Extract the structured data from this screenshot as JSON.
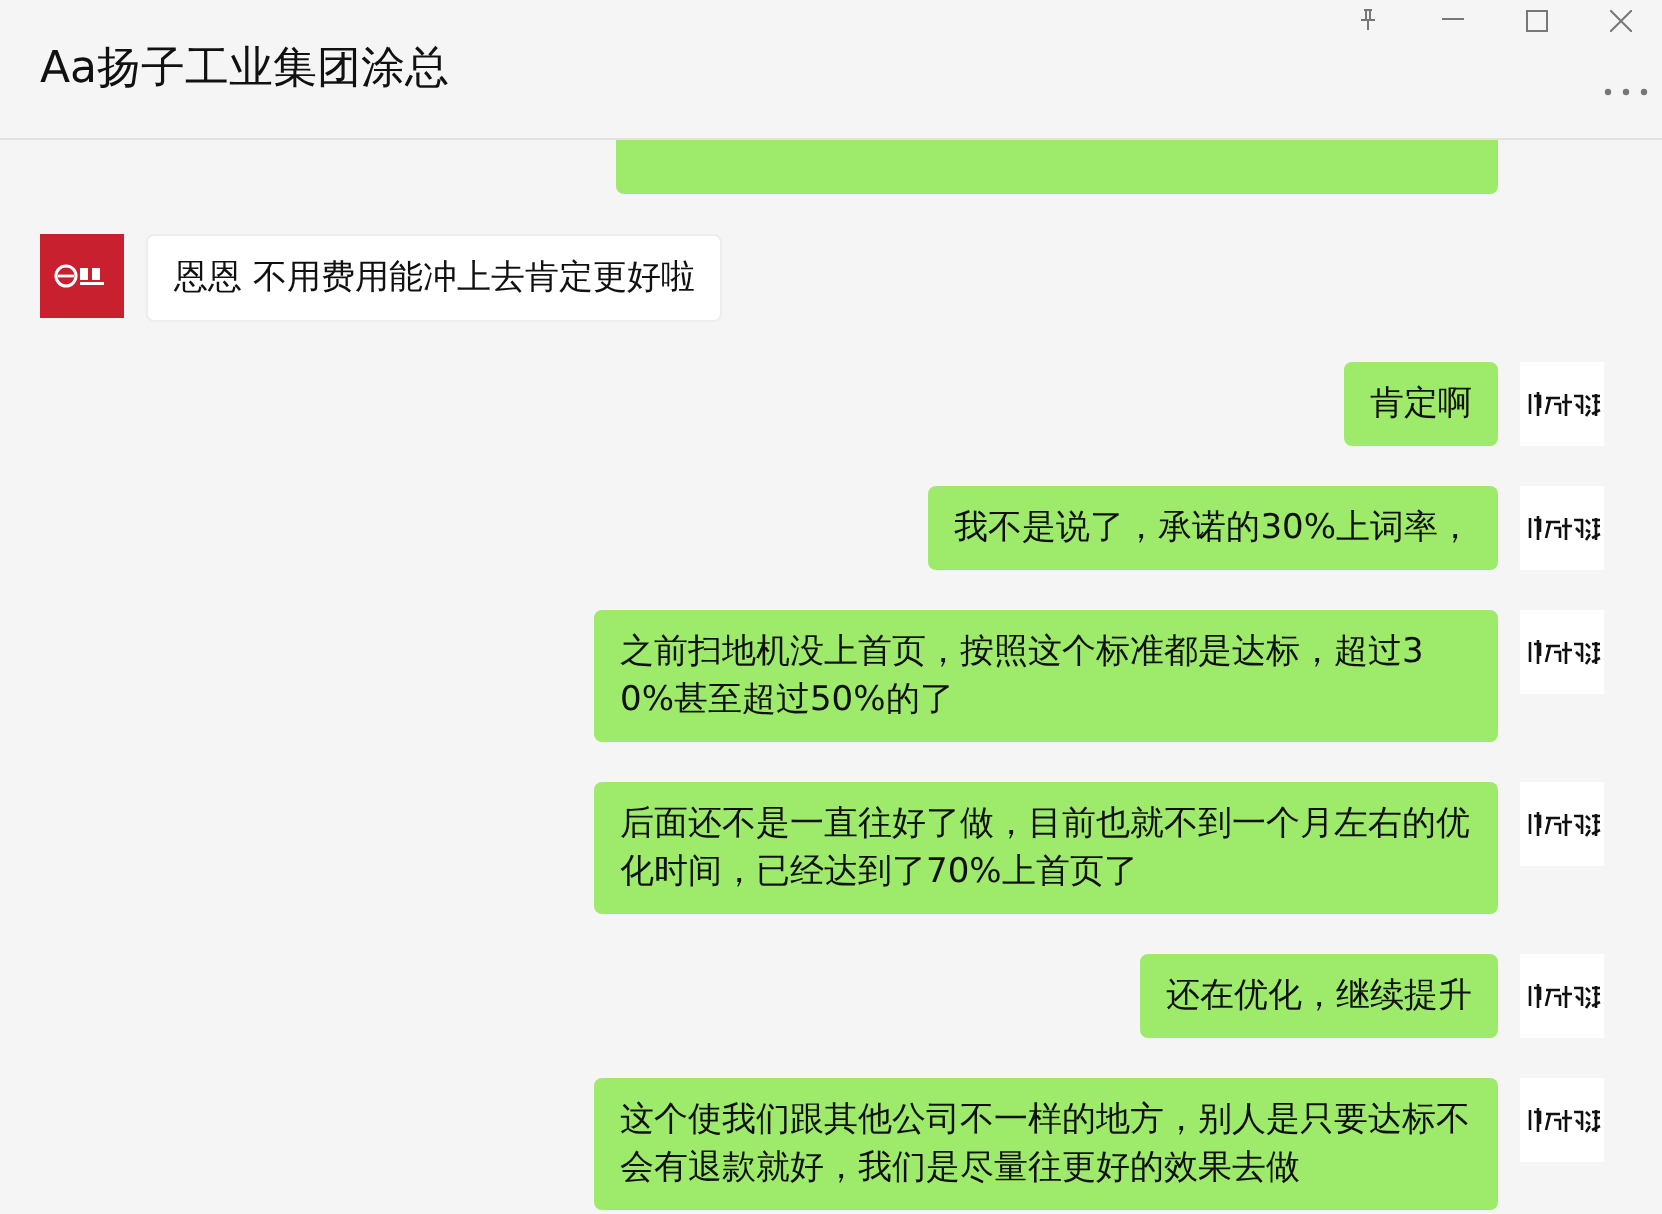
{
  "window": {
    "title": "Aa扬子工业集团涂总"
  },
  "messages": [
    {
      "kind": "sent_cut"
    },
    {
      "kind": "received",
      "text": "恩恩 不用费用能冲上去肯定更好啦"
    },
    {
      "kind": "sent",
      "text": "肯定啊"
    },
    {
      "kind": "sent",
      "text": "我不是说了，承诺的30%上词率，"
    },
    {
      "kind": "sent",
      "text": "之前扫地机没上首页，按照这个标准都是达标，超过30%甚至超过50%的了"
    },
    {
      "kind": "sent",
      "text": "后面还不是一直往好了做，目前也就不到一个月左右的优化时间，已经达到了70%上首页了"
    },
    {
      "kind": "sent",
      "text": "还在优化，继续提升"
    },
    {
      "kind": "sent",
      "text": "这个使我们跟其他公司不一样的地方，别人是只要达标不会有退款就好，我们是尽量往更好的效果去做"
    }
  ]
}
